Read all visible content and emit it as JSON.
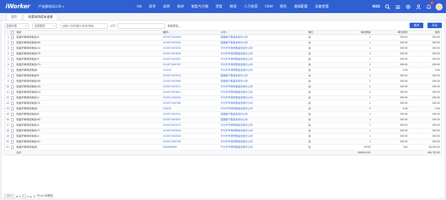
{
  "app": {
    "logo": "iWorker",
    "company": "产品部测试公司"
  },
  "nav": [
    "OA",
    "财务",
    "采购",
    "库存",
    "销售与分销",
    "零售",
    "制造",
    "人力资源",
    "CRM",
    "报告",
    "基础配置",
    "设备管理"
  ],
  "topbar": {
    "user": "MSS",
    "notifications": "2"
  },
  "tabs": [
    {
      "label": "首页",
      "active": false
    },
    {
      "label": "批量采购成本查看",
      "active": true
    }
  ],
  "filters": {
    "category": "全部分类",
    "status": "全部类型",
    "keyword_placeholder": "请输入名称/编号/机构/规格...",
    "company_label": "公司",
    "company_value": "",
    "advanced": "高级筛选",
    "query_button": "查询",
    "export_button": "导出"
  },
  "columns": [
    "商品",
    "编号",
    "公司",
    "单位",
    "库存数量",
    "单位成本",
    "成本"
  ],
  "rows": [
    {
      "idx": "1",
      "name": "批量开单测试商品24",
      "num": "2019071002009",
      "co": "智能客户数量多部分公司",
      "unit": "台",
      "qty": "1",
      "price": "200.00",
      "cost": "200.00"
    },
    {
      "idx": "2",
      "name": "批量开单测试商品280",
      "num": "2019071002003",
      "co": "智能客户数量多部分公司",
      "unit": "台",
      "qty": "1",
      "price": "200.00",
      "cost": "200.00"
    },
    {
      "idx": "3",
      "name": "批量开单测试商品114",
      "num": "2019071001578",
      "co": "不分开市场所数量多部分公司",
      "unit": "台",
      "qty": "1",
      "price": "200.00",
      "cost": "200.00"
    },
    {
      "idx": "4",
      "name": "批量开单测试商品275",
      "num": "2019071001836",
      "co": "不分开市场所数量多部分公司",
      "unit": "台",
      "qty": "1",
      "price": "200.00",
      "cost": "200.00"
    },
    {
      "idx": "5",
      "name": "批量开单测试商品70",
      "num": "2019071000531",
      "co": "不分开市场所数量多部分公司",
      "unit": "台",
      "qty": "1",
      "price": "200.00",
      "cost": "200.00"
    },
    {
      "idx": "6",
      "name": "批量开单测试商品270",
      "num": "2019071000787",
      "co": "不分开市场所数量多部分公司",
      "unit": "台",
      "qty": "1",
      "price": "200.00",
      "cost": "200.00"
    },
    {
      "idx": "7",
      "name": "批量开单测试商品1",
      "num": "121213",
      "co": "不分开市场所数量多部分公司",
      "unit": "台",
      "qty": "4",
      "price": "0.00",
      "cost": "0.00"
    },
    {
      "idx": "8",
      "name": "批量开单测试商品25",
      "num": "2019071002010",
      "co": "智能客户数量多部分公司",
      "unit": "台",
      "qty": "1",
      "price": "200.00",
      "cost": "200.00"
    },
    {
      "idx": "9",
      "name": "批量开单测试商品285",
      "num": "2019071002066",
      "co": "智能客户数量多部分公司",
      "unit": "台",
      "qty": "1",
      "price": "200.00",
      "cost": "200.00"
    },
    {
      "idx": "10",
      "name": "批量开单测试商品105",
      "num": "2019071001571",
      "co": "不分开市场所数量多部分公司",
      "unit": "台",
      "qty": "1",
      "price": "200.00",
      "cost": "200.00"
    },
    {
      "idx": "11",
      "name": "批量开单测试商品210",
      "num": "2019071001627",
      "co": "不分开市场所数量多部分公司",
      "unit": "台",
      "qty": "1",
      "price": "200.00",
      "cost": "200.00"
    },
    {
      "idx": "12",
      "name": "批量开单测试商品13",
      "num": "2019071000532",
      "co": "不分开市场所数量多部分公司",
      "unit": "台",
      "qty": "1",
      "price": "200.00",
      "cost": "200.00"
    },
    {
      "idx": "13",
      "name": "批量开单测试商品271",
      "num": "2019071000786",
      "co": "不分开市场所数量多部分公司",
      "unit": "台",
      "qty": "1",
      "price": "200.00",
      "cost": "200.00"
    },
    {
      "idx": "14",
      "name": "批量开单测试商品1",
      "num": "234232",
      "co": "不分开市场所数量多部分公司",
      "unit": "台",
      "qty": "4",
      "price": "0.00",
      "cost": "0.00"
    },
    {
      "idx": "15",
      "name": "批量开单测试商品26",
      "num": "2019071002011",
      "co": "智能客户数量多部分公司",
      "unit": "台",
      "qty": "1",
      "price": "200.00",
      "cost": "200.00"
    },
    {
      "idx": "16",
      "name": "批量开单测试商品282",
      "num": "2019071002067",
      "co": "智能客户数量多部分公司",
      "unit": "台",
      "qty": "1",
      "price": "200.00",
      "cost": "200.00"
    },
    {
      "idx": "17",
      "name": "批量开单测试商品16",
      "num": "2019071001572",
      "co": "不分开市场所数量多部分公司",
      "unit": "台",
      "qty": "1",
      "price": "200.00",
      "cost": "200.00"
    },
    {
      "idx": "18",
      "name": "批量开单测试商品277",
      "num": "2019071001628",
      "co": "不分开市场所数量多部分公司",
      "unit": "台",
      "qty": "1",
      "price": "200.00",
      "cost": "200.00"
    },
    {
      "idx": "19",
      "name": "批量开单测试商品16",
      "num": "2019071000533",
      "co": "不分开市场所数量多部分公司",
      "unit": "台",
      "qty": "1",
      "price": "200.00",
      "cost": "200.00"
    },
    {
      "idx": "20",
      "name": "批量开单测试商品212",
      "num": "2019071000789",
      "co": "不分开市场所数量多部分公司",
      "unit": "台",
      "qty": "1",
      "price": "200.00",
      "cost": "200.00"
    },
    {
      "idx": "21",
      "name": "批量开单测试商品1",
      "num": "9080800808",
      "co": "不分开市场所数量多部分公司",
      "unit": "台",
      "qty": "10799",
      "price": "7.80",
      "cost": "84,232.20"
    }
  ],
  "totals": {
    "label": "合计",
    "qty": "108451.000",
    "cost": "464,752.80"
  },
  "pager": {
    "size": "100",
    "page": "1",
    "total": "共1167条数据"
  }
}
